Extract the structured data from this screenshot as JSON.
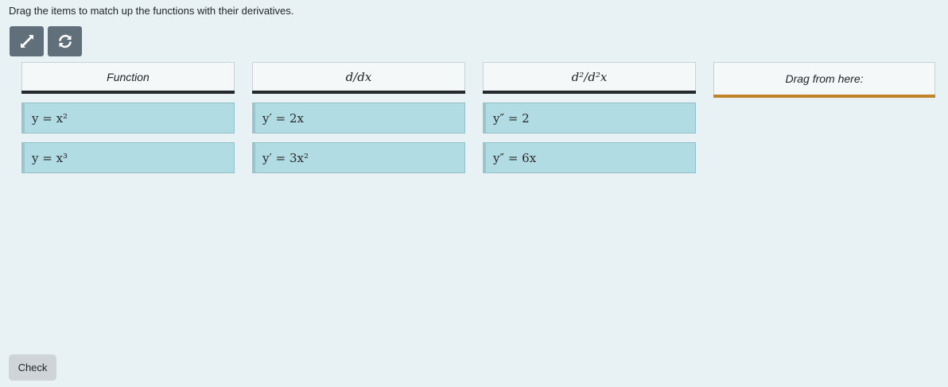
{
  "instructions": "Drag the items to match up the functions with their derivatives.",
  "toolbar": {
    "fullscreen_icon": "expand-arrows-icon",
    "reset_icon": "refresh-icon"
  },
  "columns": [
    {
      "header": "Function",
      "cards": [
        "y = x²",
        "y = x³"
      ]
    },
    {
      "header": "d/dx",
      "cards": [
        "y′ = 2x",
        "y′ = 3x²"
      ]
    },
    {
      "header": "d²/d²x",
      "cards": [
        "y″ = 2",
        "y″ = 6x"
      ]
    },
    {
      "header": "Drag from here:",
      "cards": []
    }
  ],
  "check_label": "Check",
  "colors": {
    "background": "#e8f1f3",
    "card": "#b1dce3",
    "header_underline": "#22282c",
    "source_underline": "#c2842a",
    "toolbar_button": "#616f7b"
  }
}
